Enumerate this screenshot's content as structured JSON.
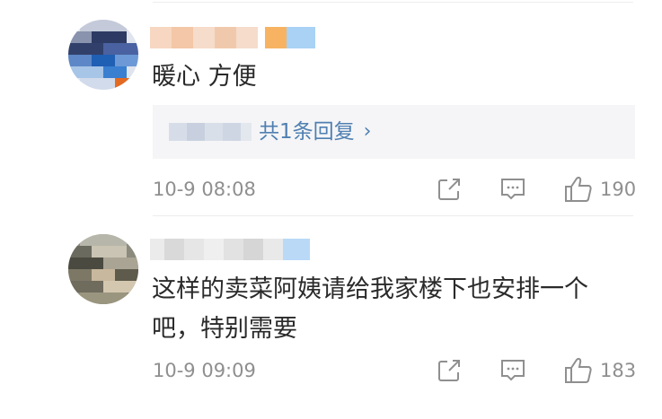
{
  "comments": [
    {
      "content": "暖心 方便",
      "replies_label": "共1条回复",
      "replies_chevron": "›",
      "timestamp": "10-9 08:08",
      "likes": "190",
      "icons": [
        "share-icon",
        "comment-icon",
        "thumbs-up-icon"
      ]
    },
    {
      "content": "这样的卖菜阿姨请给我家楼下也安排一个吧，特别需要",
      "timestamp": "10-9 09:09",
      "likes": "183",
      "icons": [
        "share-icon",
        "comment-icon",
        "thumbs-up-icon"
      ]
    }
  ],
  "colors": {
    "link": "#4f7fb1",
    "meta": "#8f8f8f",
    "text": "#2a2a2a",
    "reply_bg": "#f5f5f7"
  }
}
